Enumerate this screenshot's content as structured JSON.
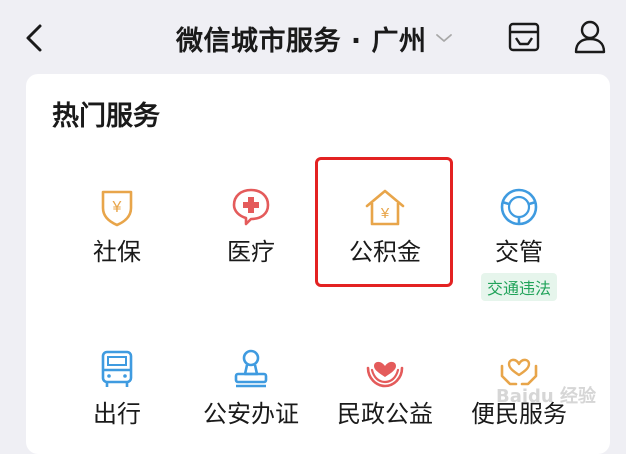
{
  "header": {
    "title": "微信城市服务 · 广州",
    "icons": [
      "back-arrow-icon",
      "chevron-down-icon",
      "inbox-icon",
      "user-icon"
    ]
  },
  "section": {
    "title": "热门服务"
  },
  "services": [
    {
      "label": "社保",
      "icon": "yuan-shield-icon",
      "color": "#e8a54a"
    },
    {
      "label": "医疗",
      "icon": "medical-cross-icon",
      "color": "#e45b5b"
    },
    {
      "label": "公积金",
      "icon": "house-yuan-icon",
      "color": "#e8a54a",
      "highlighted": true
    },
    {
      "label": "交管",
      "icon": "steering-wheel-icon",
      "color": "#3f9be0",
      "badge": "交通违法"
    },
    {
      "label": "出行",
      "icon": "bus-icon",
      "color": "#3f9be0"
    },
    {
      "label": "公安办证",
      "icon": "stamp-icon",
      "color": "#3f9be0"
    },
    {
      "label": "民政公益",
      "icon": "heart-hands-icon",
      "color": "#e45b5b"
    },
    {
      "label": "便民服务",
      "icon": "heart-care-icon",
      "color": "#e8a54a"
    }
  ],
  "colors": {
    "background": "#efeff4",
    "card": "#ffffff",
    "highlight_border": "#e32222",
    "badge_bg": "#e6f5ec",
    "badge_text": "#21a35a"
  },
  "watermark": "Baidu 经验"
}
